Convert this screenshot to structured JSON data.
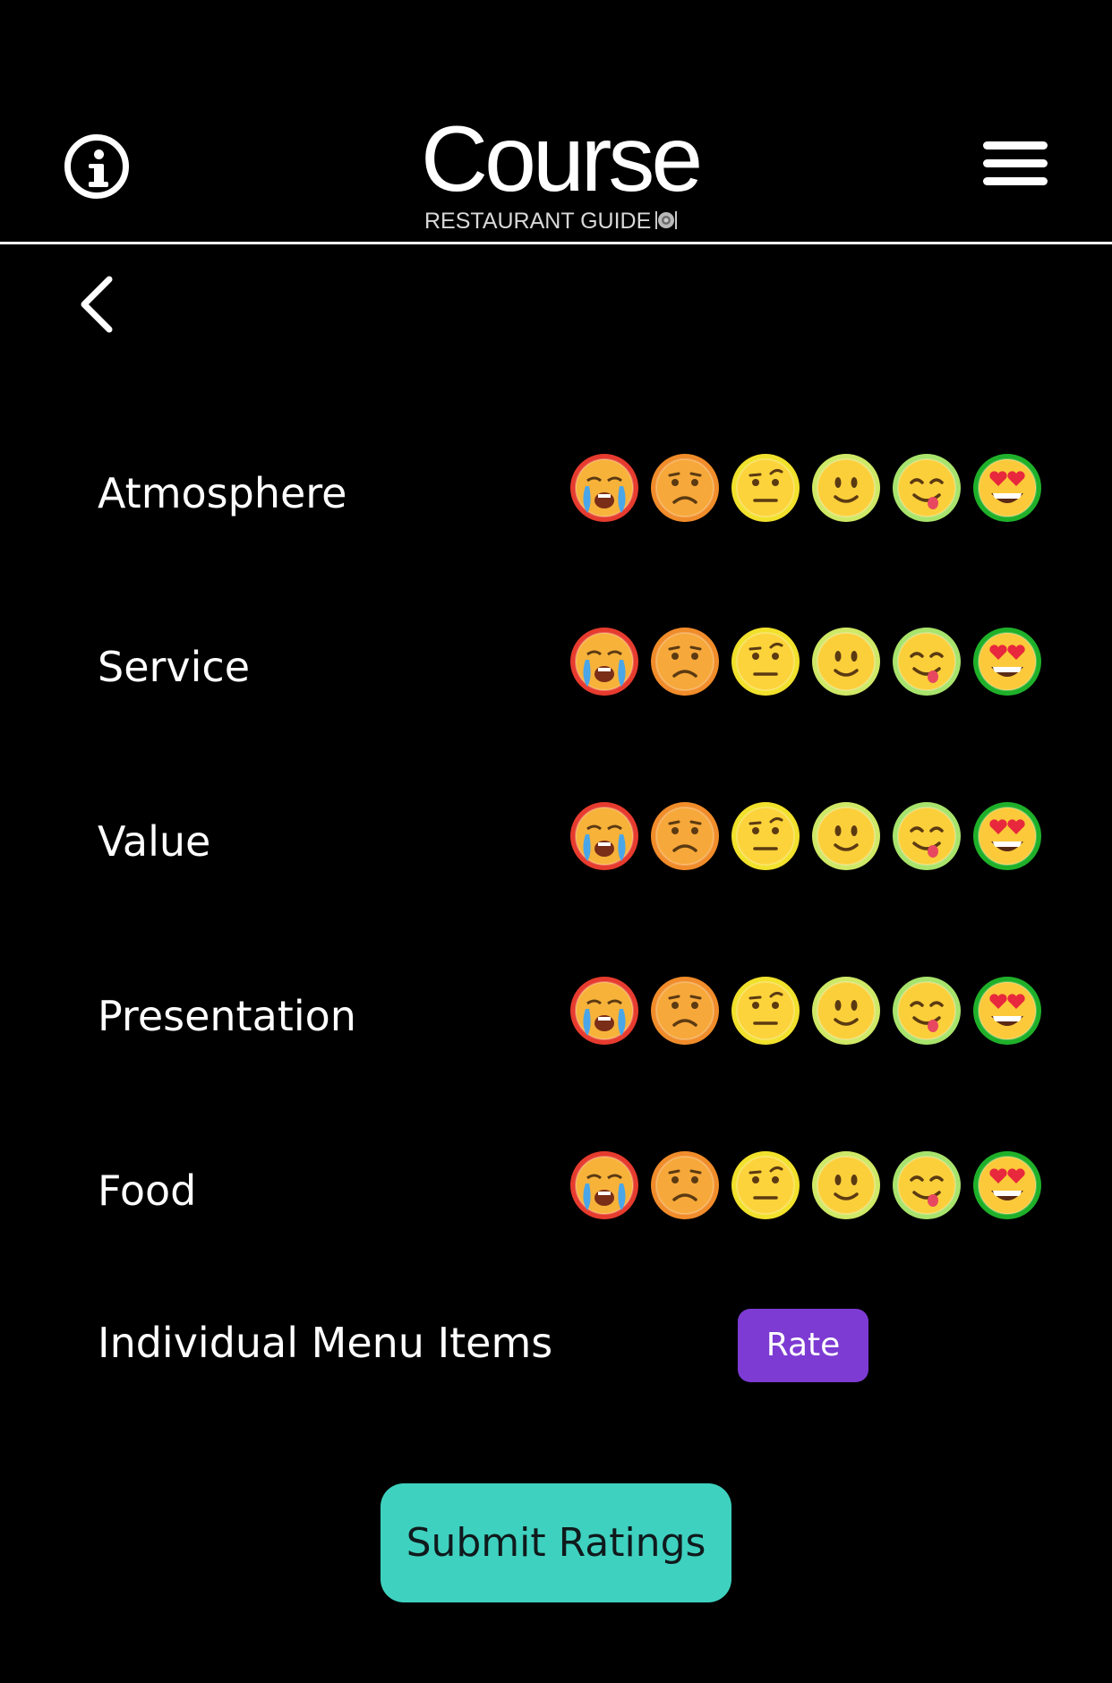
{
  "header": {
    "logo_title": "Course",
    "logo_subtitle": "RESTAURANT GUIDE",
    "info_icon": "info-circle-icon",
    "menu_icon": "hamburger-menu-icon"
  },
  "navigation": {
    "back_icon": "chevron-left-icon"
  },
  "rating_scale": [
    {
      "name": "loudly-crying-face-icon",
      "ring": "#e63b2e"
    },
    {
      "name": "frowning-face-icon",
      "ring": "#f08c2a"
    },
    {
      "name": "face-with-raised-eyebrow-icon",
      "ring": "#f2e12c"
    },
    {
      "name": "slightly-smiling-face-icon",
      "ring": "#cfe866"
    },
    {
      "name": "face-savoring-food-icon",
      "ring": "#a8e36c"
    },
    {
      "name": "smiling-face-with-heart-eyes-icon",
      "ring": "#1fb02a"
    }
  ],
  "categories": [
    {
      "label": "Atmosphere"
    },
    {
      "label": "Service"
    },
    {
      "label": "Value"
    },
    {
      "label": "Presentation"
    },
    {
      "label": "Food"
    }
  ],
  "menu_items": {
    "label": "Individual Menu Items",
    "button_label": "Rate"
  },
  "submit": {
    "label": "Submit Ratings"
  },
  "colors": {
    "background": "#000000",
    "rate_button": "#7d3bd3",
    "submit_button": "#3fd1bf",
    "text": "#ffffff"
  }
}
